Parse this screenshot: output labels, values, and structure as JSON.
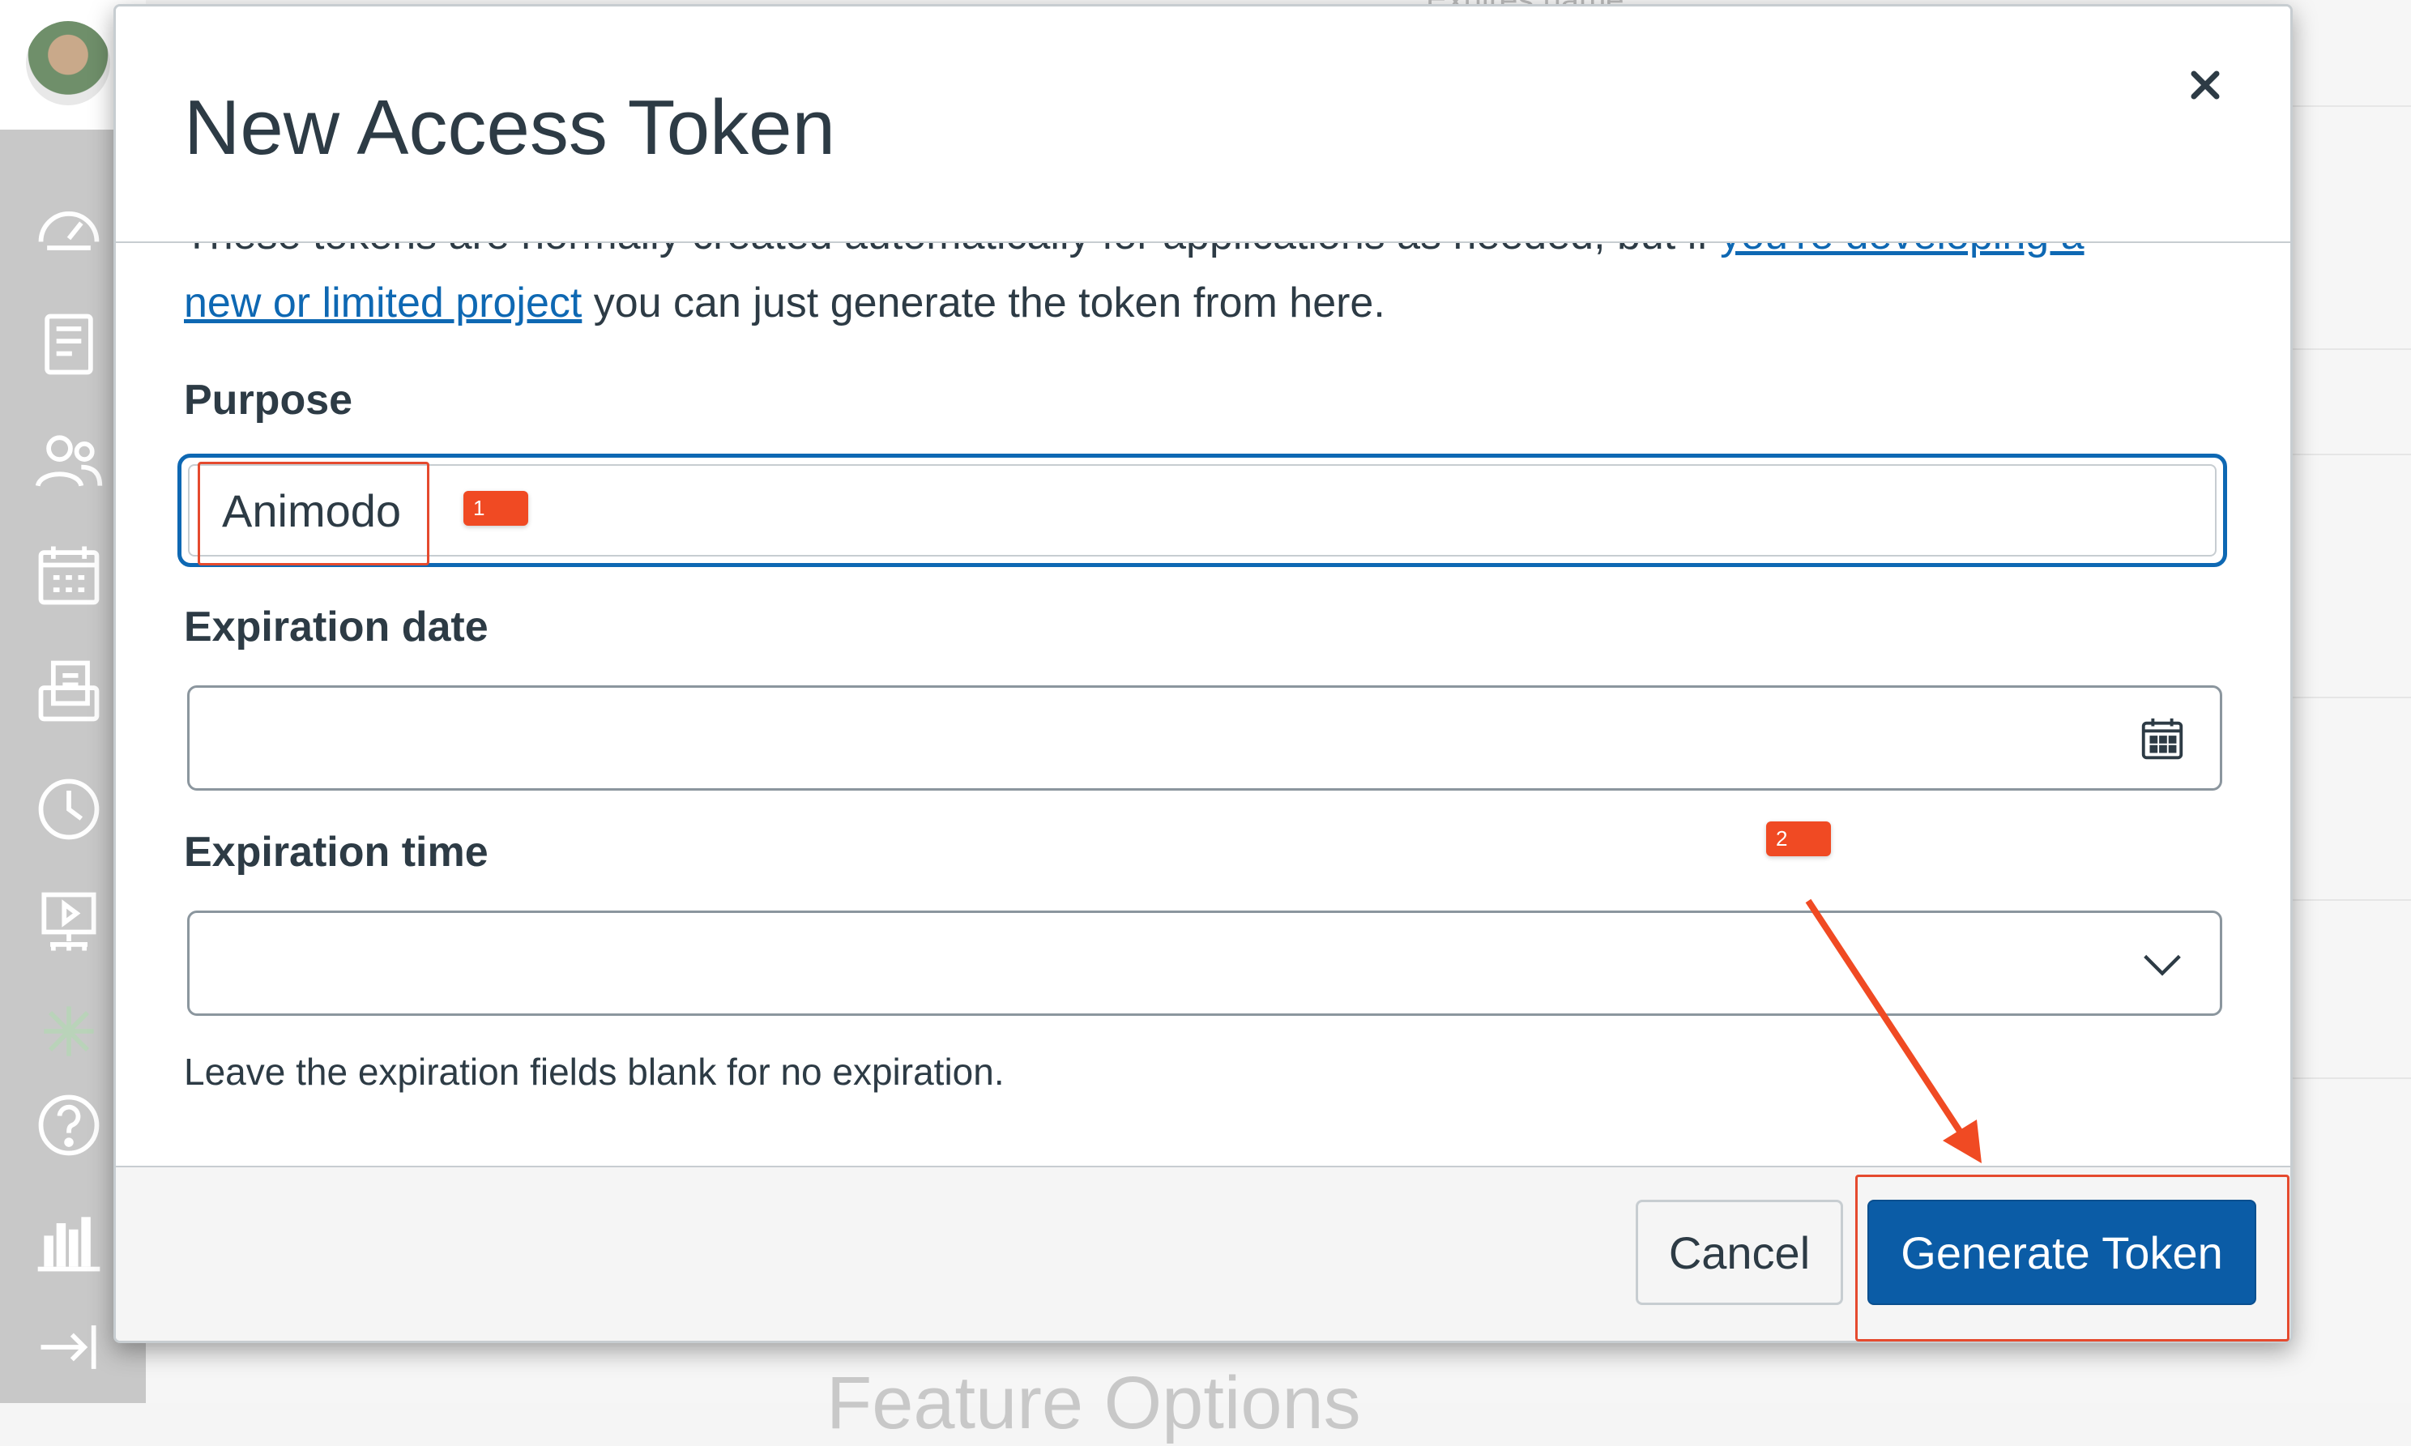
{
  "background": {
    "top_text": "Exhires      name",
    "section_heading": "Feature Options"
  },
  "modal": {
    "title": "New Access Token",
    "close_icon": "close-icon",
    "intro_text_1": "These tokens are normally created automatically for applications as needed, but if ",
    "intro_link_1": "you're developing a",
    "intro_link_2": "new or limited project",
    "intro_text_2": " you can just generate the token from here.",
    "purpose": {
      "label": "Purpose",
      "value": "Animodo"
    },
    "expiration_date": {
      "label": "Expiration date",
      "value": "",
      "icon": "calendar-icon"
    },
    "expiration_time": {
      "label": "Expiration time",
      "value": "",
      "icon": "chevron-down-icon"
    },
    "hint": "Leave the expiration fields blank for no expiration.",
    "footer": {
      "cancel_label": "Cancel",
      "generate_label": "Generate Token"
    }
  },
  "annotations": {
    "badge_1": "1",
    "badge_2": "2"
  },
  "colors": {
    "primary": "#0b5ca6",
    "link": "#0e68b3",
    "annotation": "#f04a23"
  },
  "rail_icons": [
    "dashboard-icon",
    "courses-icon",
    "groups-icon",
    "calendar-icon",
    "inbox-icon",
    "history-icon",
    "studio-icon",
    "help-icon",
    "library-icon",
    "collapse-icon"
  ]
}
